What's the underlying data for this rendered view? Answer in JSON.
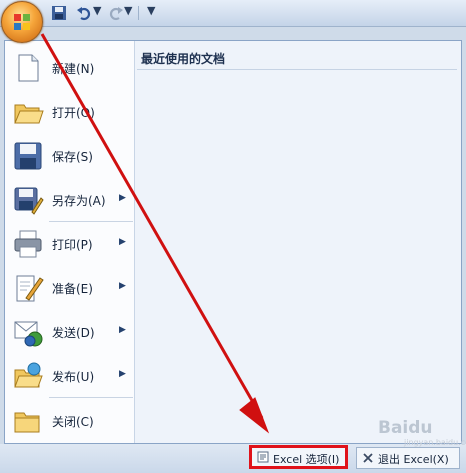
{
  "menu": {
    "items": [
      {
        "label": "新建(N)",
        "icon": "new-document-icon",
        "submenu": false
      },
      {
        "label": "打开(O)",
        "icon": "open-folder-icon",
        "submenu": false
      },
      {
        "label": "保存(S)",
        "icon": "save-disk-icon",
        "submenu": false
      },
      {
        "label": "另存为(A)",
        "icon": "save-as-icon",
        "submenu": true
      },
      {
        "label": "打印(P)",
        "icon": "printer-icon",
        "submenu": true
      },
      {
        "label": "准备(E)",
        "icon": "prepare-icon",
        "submenu": true
      },
      {
        "label": "发送(D)",
        "icon": "send-icon",
        "submenu": true
      },
      {
        "label": "发布(U)",
        "icon": "publish-icon",
        "submenu": true
      },
      {
        "label": "关闭(C)",
        "icon": "close-folder-icon",
        "submenu": false
      }
    ],
    "arrow_glyph": "▶",
    "recent_title": "最近使用的文档"
  },
  "footer": {
    "options_label": "Excel 选项(I)",
    "exit_label": "退出 Excel(X)"
  },
  "watermark": {
    "text": "Baidu",
    "sub": "jingyan.baidu.com"
  },
  "qat": {
    "more_glyph": "▼"
  },
  "colors": {
    "highlight": "#e0121a",
    "arrow": "#d01010"
  }
}
